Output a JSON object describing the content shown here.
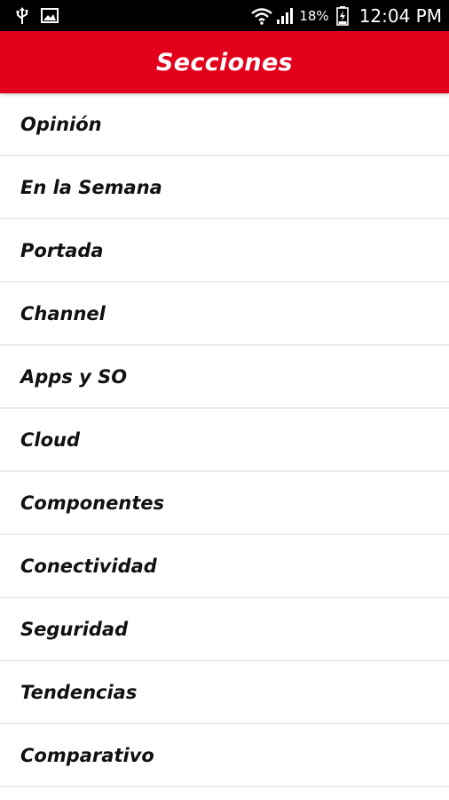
{
  "status_bar": {
    "battery_percent": "18%",
    "time": "12:04 PM",
    "icons": [
      "usb-icon",
      "image-icon",
      "wifi-icon",
      "signal-icon",
      "battery-icon"
    ]
  },
  "header": {
    "title": "Secciones",
    "accent_color": "#e3001b"
  },
  "sections": [
    {
      "label": "Opinión"
    },
    {
      "label": "En la Semana"
    },
    {
      "label": "Portada"
    },
    {
      "label": "Channel"
    },
    {
      "label": "Apps y SO"
    },
    {
      "label": "Cloud"
    },
    {
      "label": "Componentes"
    },
    {
      "label": "Conectividad"
    },
    {
      "label": "Seguridad"
    },
    {
      "label": "Tendencias"
    },
    {
      "label": "Comparativo"
    }
  ]
}
